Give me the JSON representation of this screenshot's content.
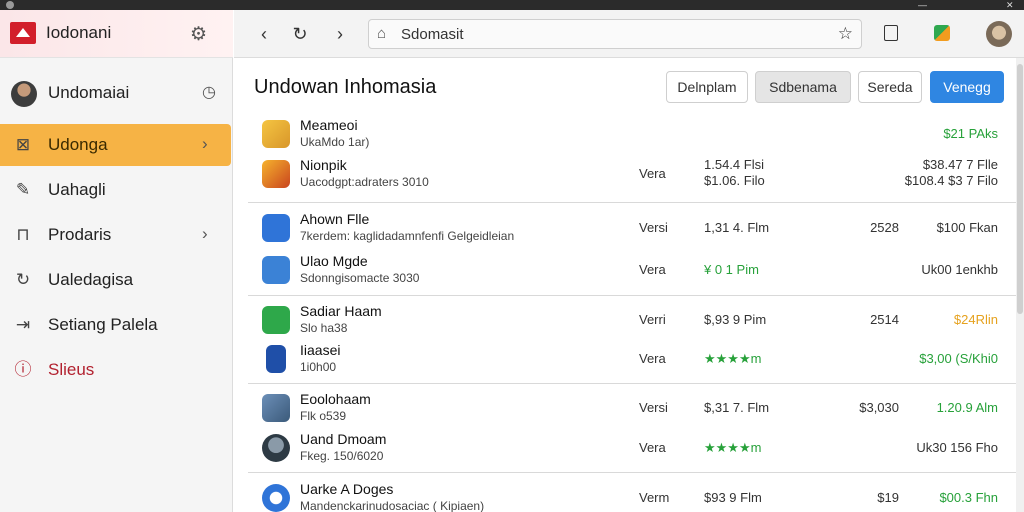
{
  "colors": {
    "accent": "#f6b345",
    "primary": "#2f86e2",
    "brand": "#d21f2b",
    "success": "#27a13a"
  },
  "brand": {
    "title": "Iodonani",
    "gear_icon": "gear-icon"
  },
  "sidebar": {
    "items": [
      {
        "label": "Undomaiai",
        "icon": "avatar"
      },
      {
        "label": "Udonga",
        "icon": "box-icon"
      },
      {
        "label": "Uahagli",
        "icon": "pencil-icon"
      },
      {
        "label": "Prodaris",
        "icon": "bag-icon"
      },
      {
        "label": "Ualedagisa",
        "icon": "refresh-icon"
      },
      {
        "label": "Setiang Palela",
        "icon": "export-icon"
      },
      {
        "label": "Slieus",
        "icon": "info-icon"
      }
    ]
  },
  "toolbar": {
    "url": "Sdomasit"
  },
  "main": {
    "title": "Undowan Inhomasia",
    "buttons": [
      "Delnplam",
      "Sdbenama",
      "Sereda",
      "Venegg"
    ],
    "groups": [
      {
        "rows": [
          {
            "name": "Meameoi",
            "sub": "UkaMdo 1ar)",
            "c1": "",
            "c2": "",
            "c3": "",
            "c4": "$21 PAks"
          },
          {
            "name": "Nionpik",
            "sub": "Uacodgpt:adraters 3010",
            "c1": "Vera",
            "c2a": "1.54.4 Flsi",
            "c2b": "$1.06. Filo",
            "c3": "",
            "c4a": "$38.47 7 Flle",
            "c4b": "$108.4 $3 7 Filo"
          }
        ]
      },
      {
        "rows": [
          {
            "name": "Ahown Flle",
            "sub": "7kerdem: kaglidadamnfenfi Gelgeidleian",
            "c1": "Versi",
            "c2": "1,31 4. Flm",
            "c3": "2528",
            "c4": "$100 Fkan"
          },
          {
            "name": "Ulao Mgde",
            "sub": "Sdonngisomacte 3030",
            "c1": "Vera",
            "c2": "¥ 0 1 Pim",
            "c3": "",
            "c4": "Uk00 1enkhb"
          }
        ]
      },
      {
        "rows": [
          {
            "name": "Sadiar Haam",
            "sub": "Slo ha38",
            "c1": "Verri",
            "c2": "$,93 9 Pim",
            "c3": "2514",
            "c4": "$24Rlin"
          },
          {
            "name": "Iiaasei",
            "sub": "1i0h00",
            "c1": "Vera",
            "c2": "★★★★m",
            "c3": "",
            "c4": "$3,00 (S/Khi0"
          }
        ]
      },
      {
        "rows": [
          {
            "name": "Eoolohaam",
            "sub": "Flk o539",
            "c1": "Versi",
            "c2": "$,31 7. Flm",
            "c3": "$3,030",
            "c4": "1.20.9 Alm"
          },
          {
            "name": "Uand Dmoam",
            "sub": "Fkeg. 150/6020",
            "c1": "Vera",
            "c2": "★★★★m",
            "c3": "",
            "c4": "Uk30 156 Fho"
          }
        ]
      },
      {
        "rows": [
          {
            "name": "Uarke A Doges",
            "sub": "Mandenckarinudosaciac ( Kipiaen)",
            "c1": "Verm",
            "c2": "$93 9 Flm",
            "c3": "$19",
            "c4": "$00.3 Fhn"
          }
        ]
      }
    ]
  }
}
